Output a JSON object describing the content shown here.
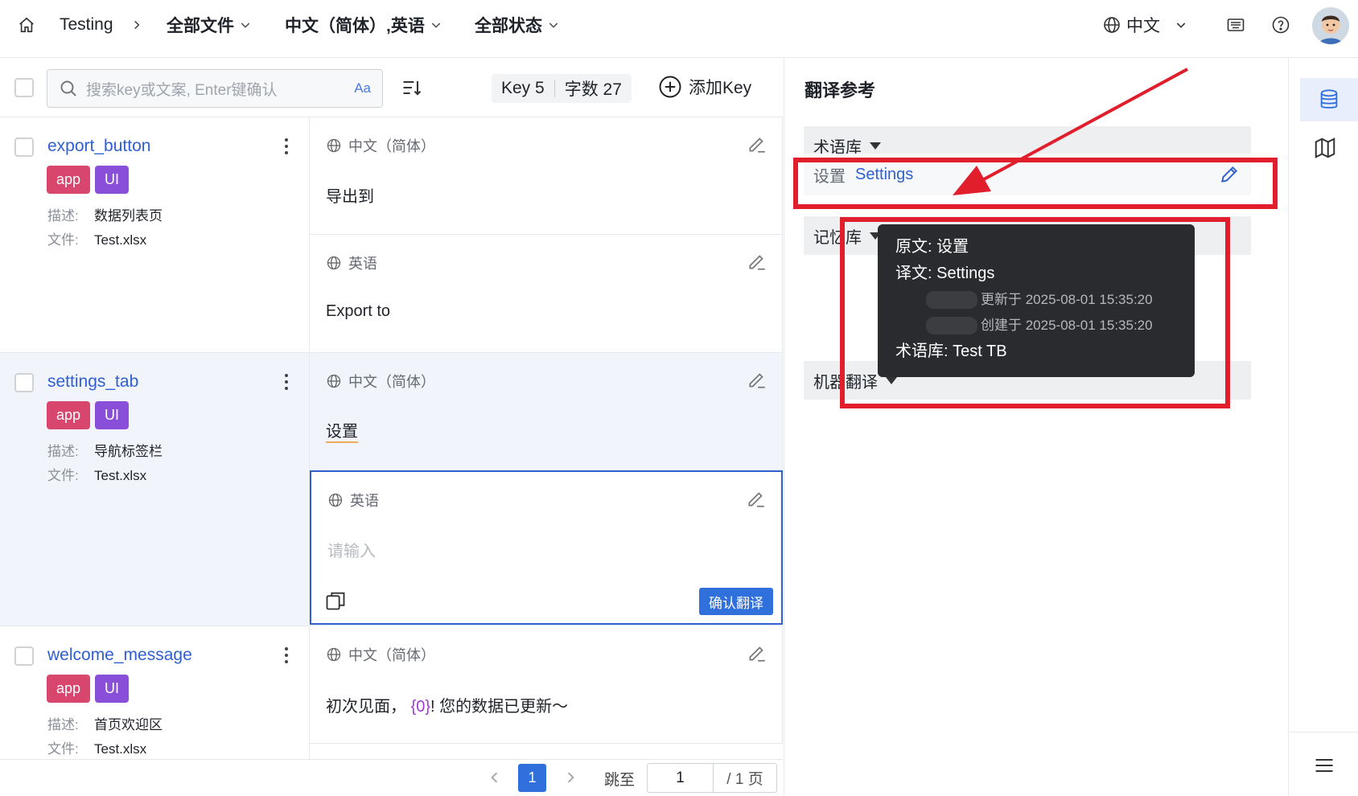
{
  "header": {
    "project": "Testing",
    "file_filter": "全部文件",
    "language_filter": "中文（简体）,英语",
    "status_filter": "全部状态",
    "ui_language": "中文"
  },
  "toolbar": {
    "search_placeholder": "搜索key或文案, Enter键确认",
    "case_toggle": "Aa",
    "key_count": "Key 5",
    "char_count": "字数 27",
    "add_key": "添加Key"
  },
  "keys": [
    {
      "name": "export_button",
      "tags": [
        "app",
        "UI"
      ],
      "desc_label": "描述:",
      "desc": "数据列表页",
      "file_label": "文件:",
      "file": "Test.xlsx",
      "translations": [
        {
          "lang": "中文（简体）",
          "text": "导出到"
        },
        {
          "lang": "英语",
          "text": "Export to"
        }
      ]
    },
    {
      "name": "settings_tab",
      "tags": [
        "app",
        "UI"
      ],
      "desc_label": "描述:",
      "desc": "导航标签栏",
      "file_label": "文件:",
      "file": "Test.xlsx",
      "translations": [
        {
          "lang": "中文（简体）",
          "text": "设置"
        },
        {
          "lang": "英语",
          "placeholder": "请输入",
          "confirm": "确认翻译"
        }
      ]
    },
    {
      "name": "welcome_message",
      "tags": [
        "app",
        "UI"
      ],
      "desc_label": "描述:",
      "desc": "首页欢迎区",
      "file_label": "文件:",
      "file": "Test.xlsx",
      "translations": [
        {
          "lang": "中文（简体）",
          "text_before": "初次见面，",
          "variable": "{0}",
          "text_after": "! 您的数据已更新～"
        }
      ]
    }
  ],
  "pagination": {
    "current": "1",
    "jump_label": "跳至",
    "jump_value": "1",
    "total": "/ 1 页"
  },
  "reference_panel": {
    "title": "翻译参考",
    "termbase_section": "术语库",
    "term_source": "设置",
    "term_target": "Settings",
    "memory_section": "记忆库",
    "machine_section": "机器翻译"
  },
  "tooltip": {
    "source": "原文: 设置",
    "target": "译文: Settings",
    "updated": "更新于 2025-08-01 15:35:20",
    "created": "创建于 2025-08-01 15:35:20",
    "termbase": "术语库:  Test TB"
  },
  "colors": {
    "accent": "#2f5fd0",
    "tag_app": "#d9466d",
    "tag_ui": "#8a4fd8",
    "annotation_red": "#e01e2c",
    "variable": "#a13ad8"
  }
}
